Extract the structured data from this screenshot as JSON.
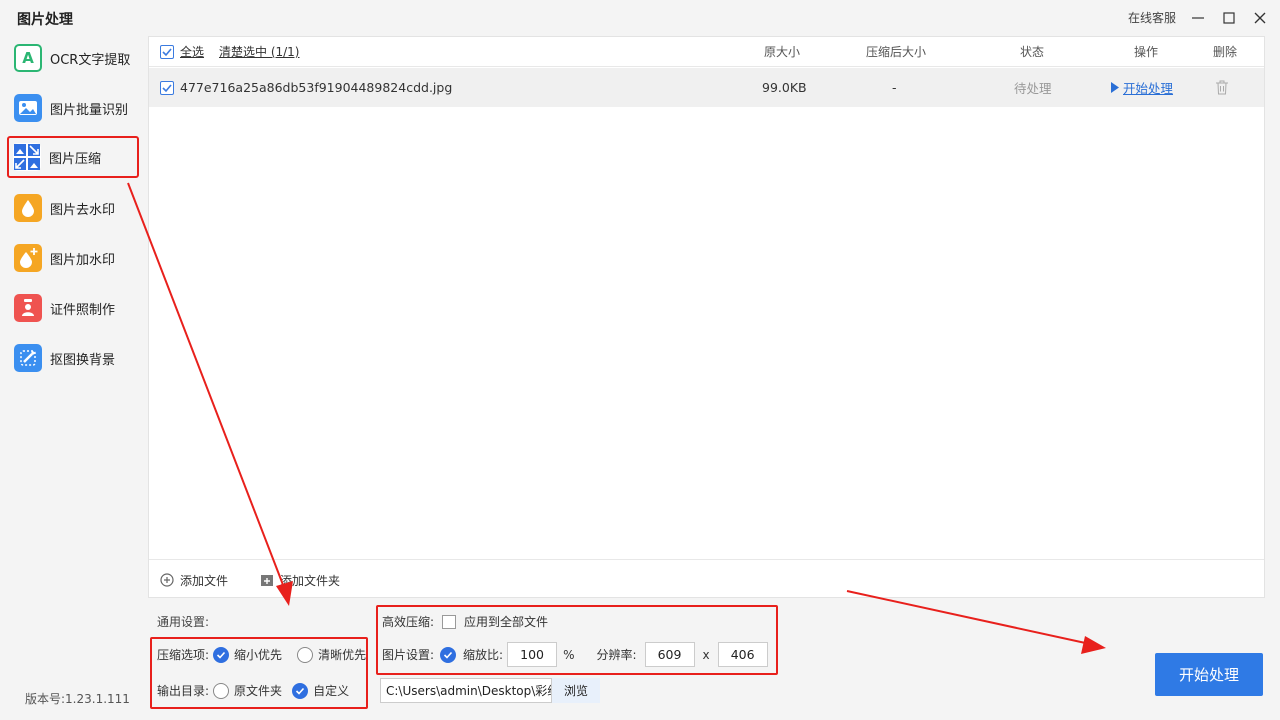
{
  "app": {
    "title": "图片处理",
    "support": "在线客服",
    "version": "版本号:1.23.1.111"
  },
  "sidebar": {
    "items": [
      {
        "label": "OCR文字提取",
        "icon": "ocr-icon",
        "color": "#2bb673"
      },
      {
        "label": "图片批量识别",
        "icon": "image-recognize-icon",
        "color": "#3b8ff0"
      },
      {
        "label": "图片压缩",
        "icon": "image-compress-icon",
        "color": "#2f6fe0",
        "active": true
      },
      {
        "label": "图片去水印",
        "icon": "remove-watermark-icon",
        "color": "#f5a623"
      },
      {
        "label": "图片加水印",
        "icon": "add-watermark-icon",
        "color": "#f5a623"
      },
      {
        "label": "证件照制作",
        "icon": "id-photo-icon",
        "color": "#ef5350"
      },
      {
        "label": "抠图换背景",
        "icon": "cutout-icon",
        "color": "#3b8ff0"
      }
    ]
  },
  "table": {
    "select_all": "全选",
    "clear_selected": "清楚选中 (1/1)",
    "columns": {
      "original_size": "原大小",
      "compressed_size": "压缩后大小",
      "status": "状态",
      "action": "操作",
      "delete": "删除"
    },
    "rows": [
      {
        "filename": "477e716a25a86db53f91904489824cdd.jpg",
        "original_size": "99.0KB",
        "compressed_size": "-",
        "status": "待处理",
        "action": "开始处理",
        "checked": true
      }
    ],
    "add_file": "添加文件",
    "add_folder": "添加文件夹"
  },
  "settings": {
    "general_label": "通用设置:",
    "compress_option_label": "压缩选项:",
    "compress_options": [
      "缩小优先",
      "清晰优先"
    ],
    "compress_selected": "缩小优先",
    "output_label": "输出目录:",
    "output_options": [
      "原文件夹",
      "自定义"
    ],
    "output_selected": "自定义",
    "efficient_label": "高效压缩:",
    "apply_all_label": "应用到全部文件",
    "image_settings_label": "图片设置:",
    "scale_label": "缩放比:",
    "scale_value": "100",
    "scale_unit": "%",
    "resolution_label": "分辨率:",
    "width": "609",
    "times": "x",
    "height": "406",
    "output_path": "C:\\Users\\admin\\Desktop\\彩纸",
    "browse": "浏览"
  },
  "start_button": "开始处理",
  "colors": {
    "accent": "#2f7ae5",
    "highlight": "#e8201c"
  }
}
